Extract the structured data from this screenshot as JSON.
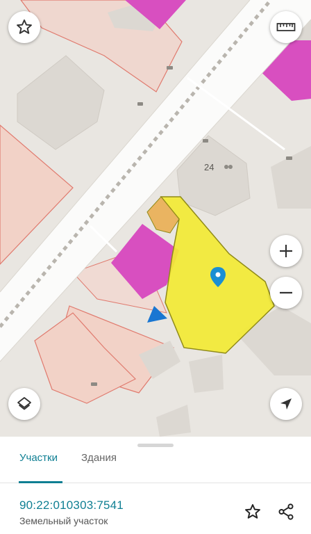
{
  "map": {
    "building_number": "24",
    "colors": {
      "background": "#e9e6e1",
      "parcel_fill": "#f2d2c7",
      "parcel_stroke": "#e07a6e",
      "magenta": "#d84fc0",
      "selected": "#f2ea34",
      "selected_stroke": "#8f8a19",
      "orange_spot": "#eab15a",
      "road": "#fbfbfa",
      "pin": "#1a8fd3",
      "location_arrow": "#1976d2"
    },
    "controls": {
      "favorite_icon": "star-outline-icon",
      "ruler_icon": "ruler-icon",
      "zoom_in_icon": "plus-icon",
      "zoom_out_icon": "minus-icon",
      "layers_icon": "layers-icon",
      "locate_icon": "navigation-arrow-icon"
    }
  },
  "sheet": {
    "tabs": [
      {
        "label": "Участки",
        "active": true
      },
      {
        "label": "Здания",
        "active": false
      }
    ],
    "parcel_id": "90:22:010303:7541",
    "parcel_type": "Земельный участок",
    "actions": {
      "favorite_icon": "star-outline-icon",
      "share_icon": "share-icon"
    }
  }
}
